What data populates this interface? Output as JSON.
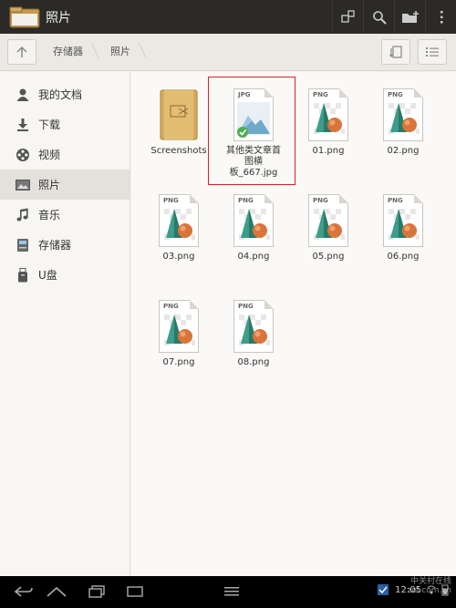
{
  "actionbar": {
    "title": "照片",
    "actions": [
      "select-icon",
      "search-icon",
      "new-folder-icon",
      "overflow-menu-icon"
    ]
  },
  "pathbar": {
    "crumbs": [
      "存储器",
      "照片"
    ]
  },
  "sidebar": {
    "items": [
      {
        "label": "我的文档",
        "icon": "person-icon"
      },
      {
        "label": "下载",
        "icon": "download-icon"
      },
      {
        "label": "视频",
        "icon": "film-reel-icon"
      },
      {
        "label": "照片",
        "icon": "photo-icon",
        "selected": true
      },
      {
        "label": "音乐",
        "icon": "music-note-icon"
      },
      {
        "label": "存储器",
        "icon": "storage-icon"
      },
      {
        "label": "U盘",
        "icon": "usb-drive-icon"
      }
    ]
  },
  "files": [
    {
      "name": "Screenshots",
      "type": "folder"
    },
    {
      "name": "其他类文章首图横板_667.jpg",
      "name_lines": [
        "其他类文章首",
        "图横",
        "板_667.jpg"
      ],
      "type": "jpg",
      "ext": "JPG",
      "selected": true
    },
    {
      "name": "01.png",
      "type": "png",
      "ext": "PNG"
    },
    {
      "name": "02.png",
      "type": "png",
      "ext": "PNG"
    },
    {
      "name": "03.png",
      "type": "png",
      "ext": "PNG"
    },
    {
      "name": "04.png",
      "type": "png",
      "ext": "PNG"
    },
    {
      "name": "05.png",
      "type": "png",
      "ext": "PNG"
    },
    {
      "name": "06.png",
      "type": "png",
      "ext": "PNG"
    },
    {
      "name": "07.png",
      "type": "png",
      "ext": "PNG"
    },
    {
      "name": "08.png",
      "type": "png",
      "ext": "PNG"
    }
  ],
  "statusbar": {
    "time": "12:05"
  },
  "watermark": {
    "text": "中关村在线 zol.com.cn"
  },
  "colors": {
    "actionbar_bg": "#2b2a28",
    "selection_border": "#dd2222",
    "system_bar_bg": "#000000"
  }
}
